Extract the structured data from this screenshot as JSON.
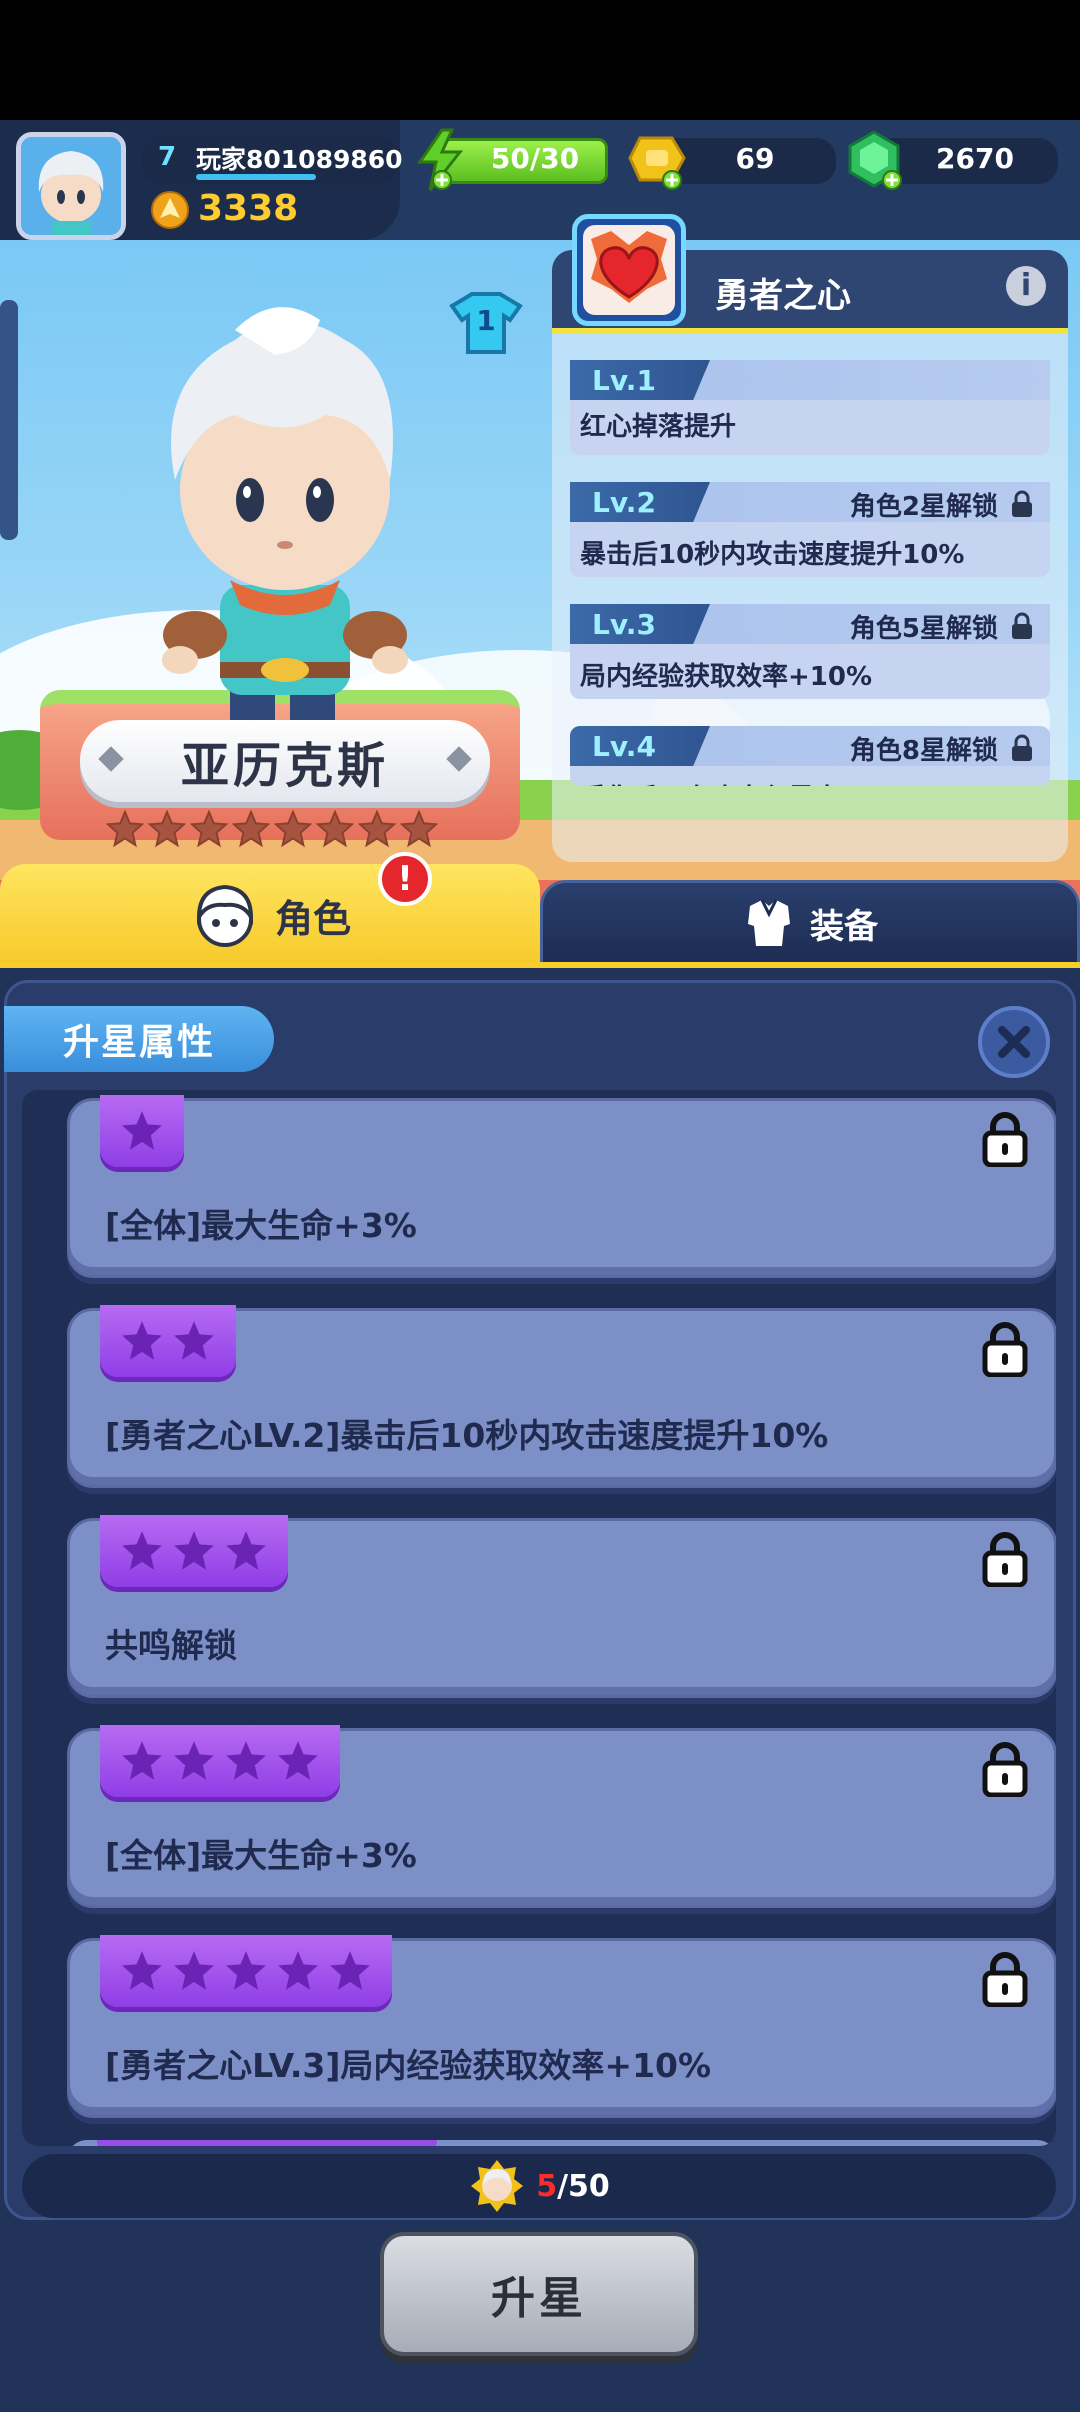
{
  "header": {
    "player_level": "7",
    "player_name": "玩家801089860",
    "power": "3338",
    "stamina": "50/30",
    "coins": "69",
    "gems": "2670"
  },
  "character": {
    "name": "亚历克斯",
    "outfit_badge": "1",
    "stars_total": 8,
    "stars_filled": 0
  },
  "skill_panel": {
    "title": "勇者之心",
    "levels": [
      {
        "level": "Lv.1",
        "unlock": "",
        "desc": "红心掉落提升",
        "locked": false
      },
      {
        "level": "Lv.2",
        "unlock": "角色2星解锁",
        "desc": "暴击后10秒内攻击速度提升10%",
        "locked": true
      },
      {
        "level": "Lv.3",
        "unlock": "角色5星解锁",
        "desc": "局内经验获取效率+10%",
        "locked": true
      },
      {
        "level": "Lv.4",
        "unlock": "角色8星解锁",
        "desc": "受伤后下次攻击必暴击",
        "locked": true
      }
    ]
  },
  "tabs": {
    "character_label": "角色",
    "equipment_label": "装备",
    "alert_badge": "!"
  },
  "star_panel": {
    "title": "升星属性",
    "items": [
      {
        "stars": 1,
        "text": "[全体]最大生命+3%"
      },
      {
        "stars": 2,
        "text": "[勇者之心LV.2]暴击后10秒内攻击速度提升10%"
      },
      {
        "stars": 3,
        "text": "共鸣解锁"
      },
      {
        "stars": 4,
        "text": "[全体]最大生命+3%"
      },
      {
        "stars": 5,
        "text": "[勇者之心LV.3]局内经验获取效率+10%"
      }
    ],
    "shard_current": "5",
    "shard_total": "/50",
    "upgrade_label": "升星"
  },
  "colors": {
    "accent_yellow": "#f7cf2b",
    "navy": "#233a63",
    "purple": "#9a4ce9",
    "card_bg": "#7d8fc7",
    "stamina_green": "#7fdb2f"
  }
}
